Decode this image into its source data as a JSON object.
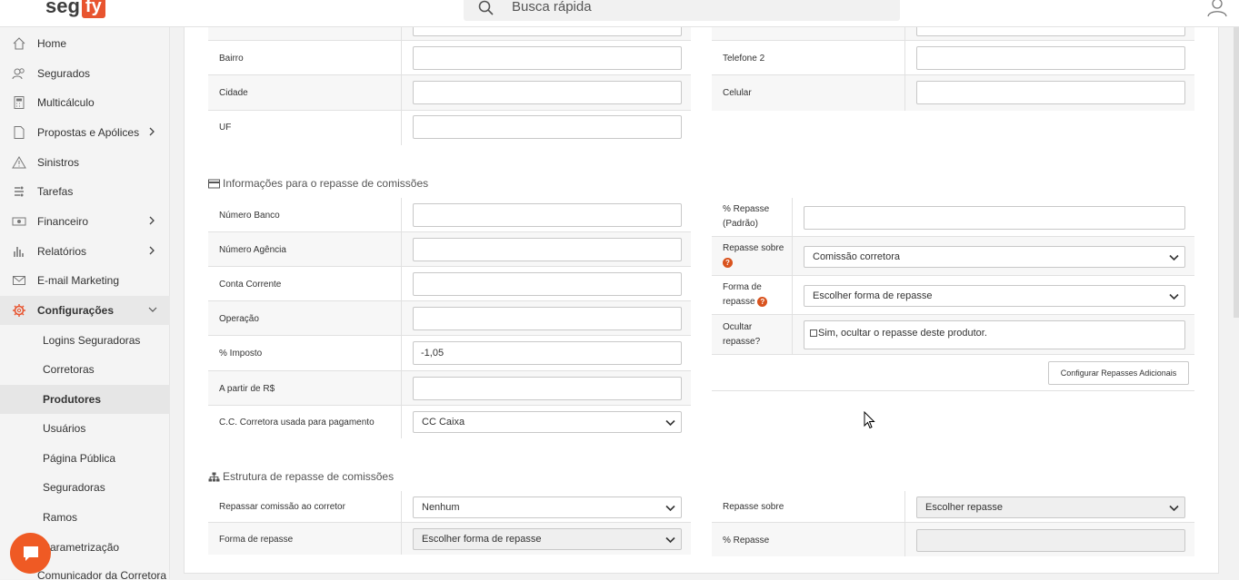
{
  "header": {
    "logo_text": "seg",
    "logo_box": "fy",
    "search_placeholder": "Busca rápida"
  },
  "sidebar": {
    "items": [
      {
        "label": "Home",
        "icon": "home-icon"
      },
      {
        "label": "Segurados",
        "icon": "users-icon"
      },
      {
        "label": "Multicálculo",
        "icon": "calculator-icon"
      },
      {
        "label": "Propostas e Apólices",
        "icon": "document-icon"
      },
      {
        "label": "Sinistros",
        "icon": "warning-icon"
      },
      {
        "label": "Tarefas",
        "icon": "tasks-icon"
      },
      {
        "label": "Financeiro",
        "icon": "money-icon"
      },
      {
        "label": "Relatórios",
        "icon": "bar-chart-icon"
      },
      {
        "label": "E-mail Marketing",
        "icon": "mail-icon"
      },
      {
        "label": "Configurações",
        "icon": "gear-icon"
      }
    ],
    "subitems": [
      "Logins Seguradoras",
      "Corretoras",
      "Produtores",
      "Usuários",
      "Página Pública",
      "Seguradoras",
      "Ramos",
      "Parametrização",
      "Comunicador da Corretora"
    ]
  },
  "address": {
    "left_labels": [
      "Bairro",
      "Cidade",
      "UF"
    ],
    "right_labels": [
      "Telefone 2",
      "Celular"
    ]
  },
  "commission": {
    "title": "Informações para o repasse de comissões",
    "left_labels": [
      "Número Banco",
      "Número Agência",
      "Conta Corrente",
      "Operação",
      "% Imposto",
      "A partir de R$",
      "C.C. Corretora usada para pagamento"
    ],
    "imposto_value": "-1,05",
    "cc_value": "CC Caixa",
    "repasse_padrao_label_1": "% Repasse",
    "repasse_padrao_label_2": "(Padrão)",
    "repasse_sobre_label": "Repasse sobre",
    "repasse_sobre_value": "Comissão corretora",
    "forma_label_1": "Forma de",
    "forma_label_2": "repasse",
    "forma_value": "Escolher forma de repasse",
    "ocultar_label_1": "Ocultar",
    "ocultar_label_2": "repasse?",
    "ocultar_checkbox_label": "Sim, ocultar o repasse deste produtor.",
    "config_button": "Configurar Repasses Adicionais"
  },
  "structure": {
    "title": "Estrutura de repasse de comissões",
    "repassar_label": "Repassar comissão ao corretor",
    "repassar_value": "Nenhum",
    "forma_label": "Forma de repasse",
    "forma_value": "Escolher forma de repasse",
    "repasse_sobre_label": "Repasse sobre",
    "repasse_sobre_value": "Escolher repasse",
    "percent_label": "% Repasse"
  }
}
